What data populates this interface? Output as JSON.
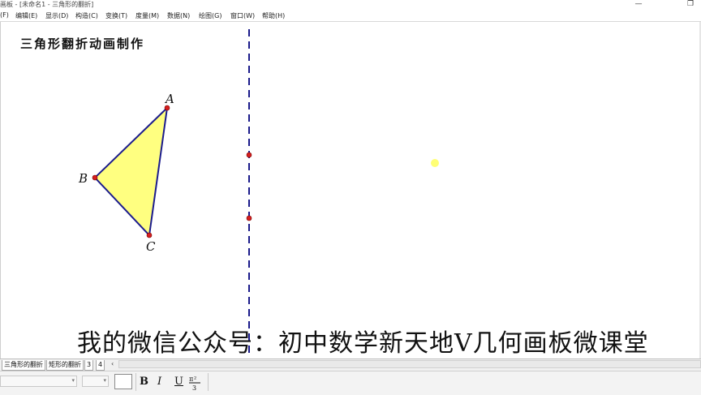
{
  "window": {
    "title": "画板 - [未命名1 - 三角形的翻折]",
    "minimize_glyph": "—",
    "restore_glyph": "❐"
  },
  "menu": [
    "(F)",
    "编辑(E)",
    "显示(D)",
    "构造(C)",
    "变换(T)",
    "度量(M)",
    "数据(N)",
    "绘图(G)",
    "窗口(W)",
    "帮助(H)"
  ],
  "canvas": {
    "doc_title": "三角形翻折动画制作",
    "points": {
      "A": "A",
      "B": "B",
      "C": "C"
    },
    "caption": "我的微信公众号：初中数学新天地V几何画板微课堂"
  },
  "tabs": [
    "三角形的翻折",
    "矩形的翻折",
    "3",
    "4"
  ],
  "tab_scroll_glyph": "‹",
  "toolbar": {
    "bold": "B",
    "italic": "I",
    "underline": "U",
    "fraction_icon": "math-format-icon"
  },
  "colors": {
    "triangle_fill": "#ffff80",
    "edge": "#1b1b8c",
    "point": "#d61f1f",
    "mirror_line": "#1a1a8a",
    "highlight_dot": "#ffff66"
  }
}
